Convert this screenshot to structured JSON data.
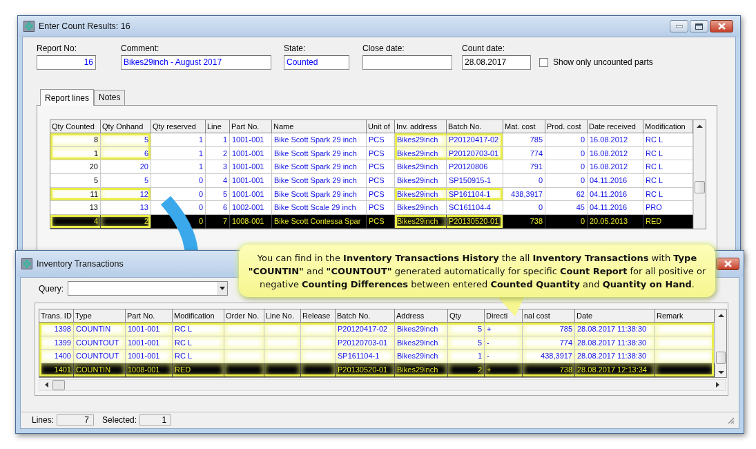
{
  "count_window": {
    "title": "Enter Count Results: 16",
    "fields": [
      {
        "label": "Report No:",
        "value": "16",
        "color": "#0000ff"
      },
      {
        "label": "Comment:",
        "value": "Bikes29inch - August 2017",
        "color": "#0000ff"
      },
      {
        "label": "State:",
        "value": "Counted",
        "color": "#0000ff"
      },
      {
        "label": "Close date:"
      },
      {
        "label": "Count date:",
        "value": "28.08.2017",
        "color": "#000000"
      }
    ],
    "checkbox": {
      "label": "Show only uncounted parts",
      "checked": false
    },
    "tabs": [
      {
        "label": "Report lines",
        "selected": true
      },
      {
        "label": "Notes",
        "selected": false
      }
    ],
    "table": {
      "columns": [
        "Qty Counted",
        "Qty Onhand",
        "Qty reserved",
        "Line",
        "Part No.",
        "Name",
        "Unit of",
        "Inv. address",
        "Batch No.",
        "Mat. cost",
        "Prod. cost",
        "Date received",
        "Modification"
      ],
      "rows": [
        {
          "cells": [
            "8",
            "5",
            "1",
            "1",
            "1001-001",
            "Bike Scott Spark 29 inch",
            "PCS",
            "Bikes29inch",
            "P20120417-02",
            "785",
            "0",
            "16.08.2012",
            "RC L"
          ],
          "selected": false,
          "highlighted": true
        },
        {
          "cells": [
            "1",
            "6",
            "1",
            "2",
            "1001-001",
            "Bike Scott Spark 29 inch",
            "PCS",
            "Bikes29inch",
            "P20120703-01",
            "774",
            "0",
            "16.08.2012",
            "RC L"
          ],
          "selected": false,
          "highlighted": true
        },
        {
          "cells": [
            "20",
            "20",
            "1",
            "3",
            "1001-001",
            "Bike Scott Spark 29 inch",
            "PCS",
            "Bikes29inch",
            "P20120806",
            "791",
            "0",
            "16.08.2012",
            "RC L"
          ],
          "selected": false,
          "highlighted": false
        },
        {
          "cells": [
            "5",
            "5",
            "0",
            "4",
            "1001-001",
            "Bike Scott Spark 29 inch",
            "PCS",
            "Bikes29inch",
            "SP150915-1",
            "0",
            "0",
            "04.11.2016",
            "RC L"
          ],
          "selected": false,
          "highlighted": false
        },
        {
          "cells": [
            "11",
            "12",
            "0",
            "5",
            "1001-001",
            "Bike Scott Spark 29 inch",
            "PCS",
            "Bikes29inch",
            "SP161104-1",
            "438,3917",
            "62",
            "04.11.2016",
            "RC L"
          ],
          "selected": false,
          "highlighted": true
        },
        {
          "cells": [
            "13",
            "13",
            "0",
            "6",
            "1002-001",
            "Bike Scott Scale 29 inch",
            "PCS",
            "Bikes29inch",
            "SC161104-4",
            "0",
            "45",
            "04.11.2016",
            "PRO"
          ],
          "selected": false,
          "highlighted": false
        },
        {
          "cells": [
            "4",
            "2",
            "0",
            "7",
            "1008-001",
            "Bike Scott Contessa Spar",
            "PCS",
            "Bikes29inch",
            "P20130520-01",
            "738",
            "0",
            "20.05.2013",
            "RED"
          ],
          "selected": true,
          "highlighted": true
        }
      ]
    }
  },
  "transactions_window": {
    "title": "Inventory Transactions",
    "query_label": "Query:",
    "table": {
      "columns": [
        "Trans. ID",
        "Type",
        "Part No.",
        "Modification",
        "Order No.",
        "Line No.",
        "Release",
        "Batch No.",
        "Address",
        "Qty",
        "Directi",
        "nal cost",
        "Date",
        "Remark"
      ],
      "rows": [
        {
          "trans_id": "1398",
          "type": "COUNTIN",
          "part_no": "1001-001",
          "modification": "RC L",
          "batch_no": "P20120417-02",
          "address": "Bikes29inch",
          "qty": "5",
          "direction": "+",
          "cost": "785",
          "date": "28.08.2017 11:38:30",
          "selected": false,
          "highlighted": true
        },
        {
          "trans_id": "1399",
          "type": "COUNTOUT",
          "part_no": "1001-001",
          "modification": "RC L",
          "batch_no": "P20120703-01",
          "address": "Bikes29inch",
          "qty": "5",
          "direction": "-",
          "cost": "774",
          "date": "28.08.2017 11:38:30",
          "selected": false,
          "highlighted": true
        },
        {
          "trans_id": "1400",
          "type": "COUNTOUT",
          "part_no": "1001-001",
          "modification": "RC L",
          "batch_no": "SP161104-1",
          "address": "Bikes29inch",
          "qty": "1",
          "direction": "-",
          "cost": "438,3917",
          "date": "28.08.2017 11:38:30",
          "selected": false,
          "highlighted": true
        },
        {
          "trans_id": "1401",
          "type": "COUNTIN",
          "part_no": "1008-001",
          "modification": "RED",
          "batch_no": "P20130520-01",
          "address": "Bikes29inch",
          "qty": "2",
          "direction": "+",
          "cost": "738",
          "date": "28.08.2017 12:13:34",
          "selected": true,
          "highlighted": true
        }
      ]
    },
    "status": [
      {
        "label": "Lines:",
        "value": "7"
      },
      {
        "label": "Selected:",
        "value": "1"
      }
    ]
  },
  "callout": {
    "text": "You can find in the **Inventory Transactions History** the all **Inventory Transactions** with **Type** **\"COUNTIN\"** and **\"COUNTOUT\"** generated automatically for specific **Count Report** for all positive or negative **Counting Differences** between entered **Counted Quantity** and **Quantity on Hand**."
  }
}
